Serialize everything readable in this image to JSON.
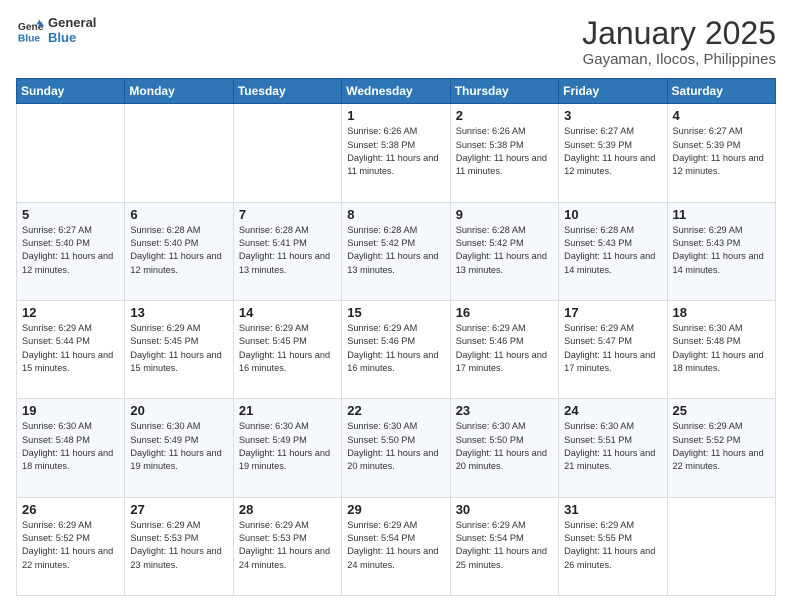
{
  "logo": {
    "line1": "General",
    "line2": "Blue"
  },
  "title": "January 2025",
  "subtitle": "Gayaman, Ilocos, Philippines",
  "days_of_week": [
    "Sunday",
    "Monday",
    "Tuesday",
    "Wednesday",
    "Thursday",
    "Friday",
    "Saturday"
  ],
  "weeks": [
    [
      {
        "day": "",
        "info": ""
      },
      {
        "day": "",
        "info": ""
      },
      {
        "day": "",
        "info": ""
      },
      {
        "day": "1",
        "info": "Sunrise: 6:26 AM\nSunset: 5:38 PM\nDaylight: 11 hours and 11 minutes."
      },
      {
        "day": "2",
        "info": "Sunrise: 6:26 AM\nSunset: 5:38 PM\nDaylight: 11 hours and 11 minutes."
      },
      {
        "day": "3",
        "info": "Sunrise: 6:27 AM\nSunset: 5:39 PM\nDaylight: 11 hours and 12 minutes."
      },
      {
        "day": "4",
        "info": "Sunrise: 6:27 AM\nSunset: 5:39 PM\nDaylight: 11 hours and 12 minutes."
      }
    ],
    [
      {
        "day": "5",
        "info": "Sunrise: 6:27 AM\nSunset: 5:40 PM\nDaylight: 11 hours and 12 minutes."
      },
      {
        "day": "6",
        "info": "Sunrise: 6:28 AM\nSunset: 5:40 PM\nDaylight: 11 hours and 12 minutes."
      },
      {
        "day": "7",
        "info": "Sunrise: 6:28 AM\nSunset: 5:41 PM\nDaylight: 11 hours and 13 minutes."
      },
      {
        "day": "8",
        "info": "Sunrise: 6:28 AM\nSunset: 5:42 PM\nDaylight: 11 hours and 13 minutes."
      },
      {
        "day": "9",
        "info": "Sunrise: 6:28 AM\nSunset: 5:42 PM\nDaylight: 11 hours and 13 minutes."
      },
      {
        "day": "10",
        "info": "Sunrise: 6:28 AM\nSunset: 5:43 PM\nDaylight: 11 hours and 14 minutes."
      },
      {
        "day": "11",
        "info": "Sunrise: 6:29 AM\nSunset: 5:43 PM\nDaylight: 11 hours and 14 minutes."
      }
    ],
    [
      {
        "day": "12",
        "info": "Sunrise: 6:29 AM\nSunset: 5:44 PM\nDaylight: 11 hours and 15 minutes."
      },
      {
        "day": "13",
        "info": "Sunrise: 6:29 AM\nSunset: 5:45 PM\nDaylight: 11 hours and 15 minutes."
      },
      {
        "day": "14",
        "info": "Sunrise: 6:29 AM\nSunset: 5:45 PM\nDaylight: 11 hours and 16 minutes."
      },
      {
        "day": "15",
        "info": "Sunrise: 6:29 AM\nSunset: 5:46 PM\nDaylight: 11 hours and 16 minutes."
      },
      {
        "day": "16",
        "info": "Sunrise: 6:29 AM\nSunset: 5:46 PM\nDaylight: 11 hours and 17 minutes."
      },
      {
        "day": "17",
        "info": "Sunrise: 6:29 AM\nSunset: 5:47 PM\nDaylight: 11 hours and 17 minutes."
      },
      {
        "day": "18",
        "info": "Sunrise: 6:30 AM\nSunset: 5:48 PM\nDaylight: 11 hours and 18 minutes."
      }
    ],
    [
      {
        "day": "19",
        "info": "Sunrise: 6:30 AM\nSunset: 5:48 PM\nDaylight: 11 hours and 18 minutes."
      },
      {
        "day": "20",
        "info": "Sunrise: 6:30 AM\nSunset: 5:49 PM\nDaylight: 11 hours and 19 minutes."
      },
      {
        "day": "21",
        "info": "Sunrise: 6:30 AM\nSunset: 5:49 PM\nDaylight: 11 hours and 19 minutes."
      },
      {
        "day": "22",
        "info": "Sunrise: 6:30 AM\nSunset: 5:50 PM\nDaylight: 11 hours and 20 minutes."
      },
      {
        "day": "23",
        "info": "Sunrise: 6:30 AM\nSunset: 5:50 PM\nDaylight: 11 hours and 20 minutes."
      },
      {
        "day": "24",
        "info": "Sunrise: 6:30 AM\nSunset: 5:51 PM\nDaylight: 11 hours and 21 minutes."
      },
      {
        "day": "25",
        "info": "Sunrise: 6:29 AM\nSunset: 5:52 PM\nDaylight: 11 hours and 22 minutes."
      }
    ],
    [
      {
        "day": "26",
        "info": "Sunrise: 6:29 AM\nSunset: 5:52 PM\nDaylight: 11 hours and 22 minutes."
      },
      {
        "day": "27",
        "info": "Sunrise: 6:29 AM\nSunset: 5:53 PM\nDaylight: 11 hours and 23 minutes."
      },
      {
        "day": "28",
        "info": "Sunrise: 6:29 AM\nSunset: 5:53 PM\nDaylight: 11 hours and 24 minutes."
      },
      {
        "day": "29",
        "info": "Sunrise: 6:29 AM\nSunset: 5:54 PM\nDaylight: 11 hours and 24 minutes."
      },
      {
        "day": "30",
        "info": "Sunrise: 6:29 AM\nSunset: 5:54 PM\nDaylight: 11 hours and 25 minutes."
      },
      {
        "day": "31",
        "info": "Sunrise: 6:29 AM\nSunset: 5:55 PM\nDaylight: 11 hours and 26 minutes."
      },
      {
        "day": "",
        "info": ""
      }
    ]
  ]
}
